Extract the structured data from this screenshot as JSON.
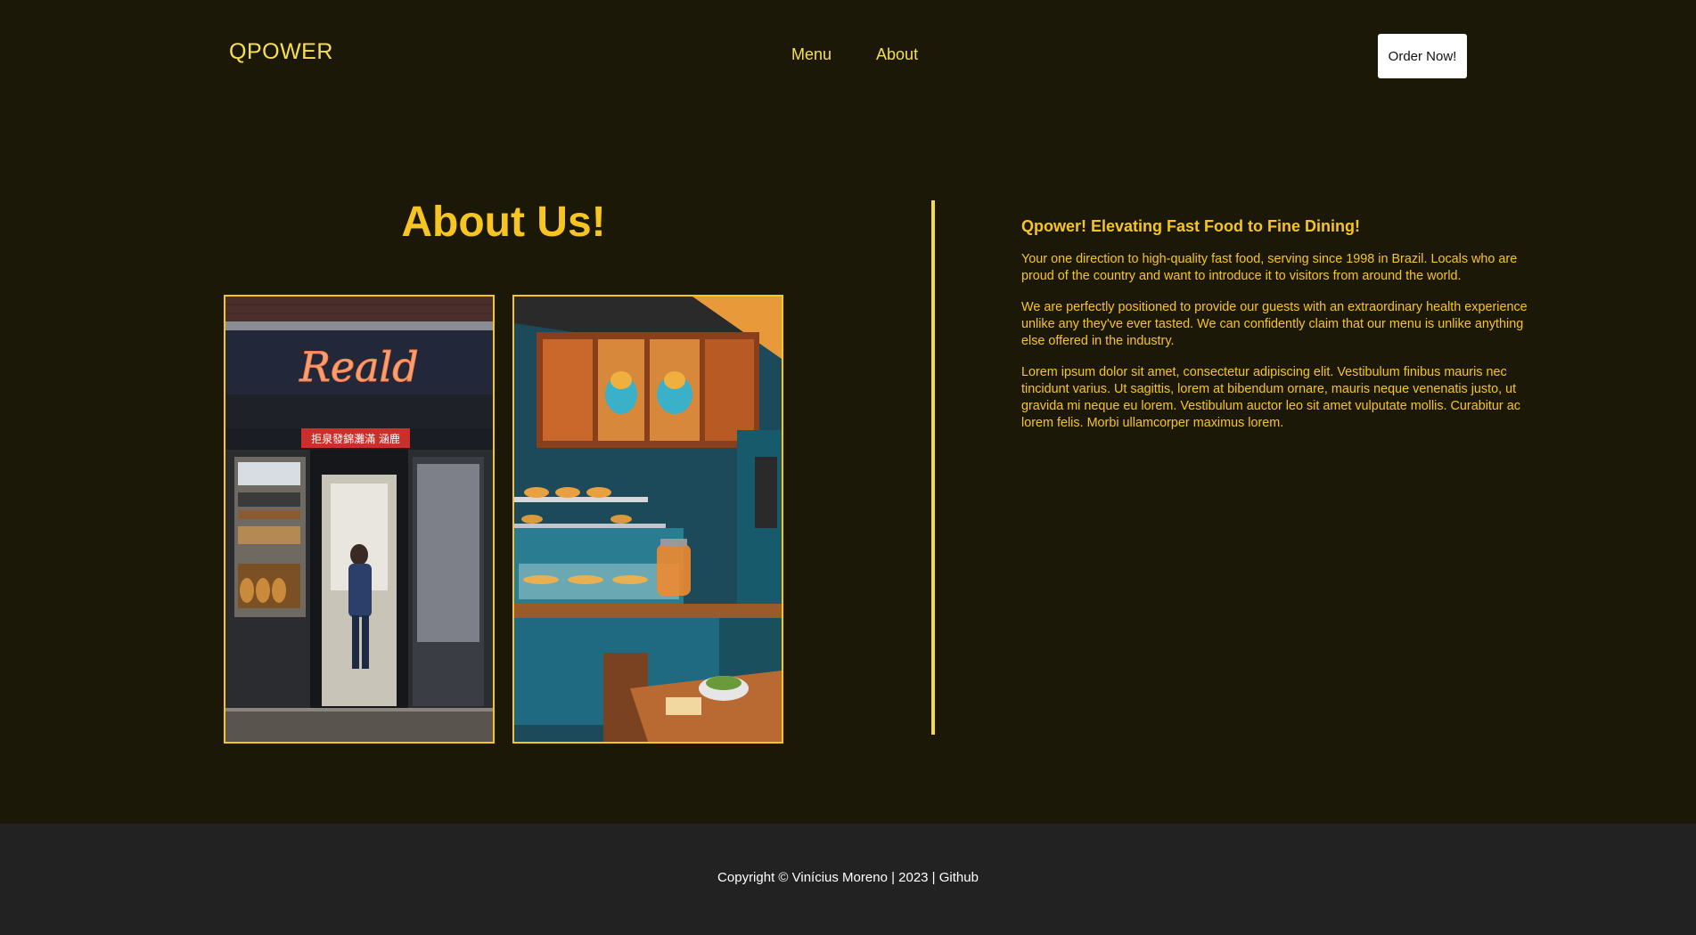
{
  "header": {
    "logo": "QPOWER",
    "nav": [
      {
        "label": "Menu"
      },
      {
        "label": "About"
      }
    ],
    "order_button": "Order Now!"
  },
  "about": {
    "title": "About Us!",
    "images": [
      {
        "sign_text": "Reald",
        "banner_text": "拒泉發錦灘滿 涵鹿"
      },
      {
        "sign_text": ""
      }
    ]
  },
  "content": {
    "heading": "Qpower! Elevating Fast Food to Fine Dining!",
    "paragraphs": [
      "Your one direction to high-quality fast food, serving since 1998 in Brazil. Locals who are proud of the country and want to introduce it to visitors from around the world.",
      "We are perfectly positioned to provide our guests with an extraordinary health experience unlike any they've ever tasted. We can confidently claim that our menu is unlike anything else offered in the industry.",
      "Lorem ipsum dolor sit amet, consectetur adipiscing elit. Vestibulum finibus mauris nec tincidunt varius. Ut sagittis, lorem at bibendum ornare, mauris neque venenatis justo, ut gravida mi neque eu lorem. Vestibulum auctor leo sit amet vulputate mollis. Curabitur ac lorem felis. Morbi ullamcorper maximus lorem."
    ]
  },
  "footer": {
    "copyright": "Copyright © Vinícius Moreno | 2023 |",
    "github": "Github"
  },
  "colors": {
    "background": "#1c1808",
    "accent": "#f6c521",
    "logo_nav": "#f5e04f",
    "footer_bg": "#222222"
  }
}
